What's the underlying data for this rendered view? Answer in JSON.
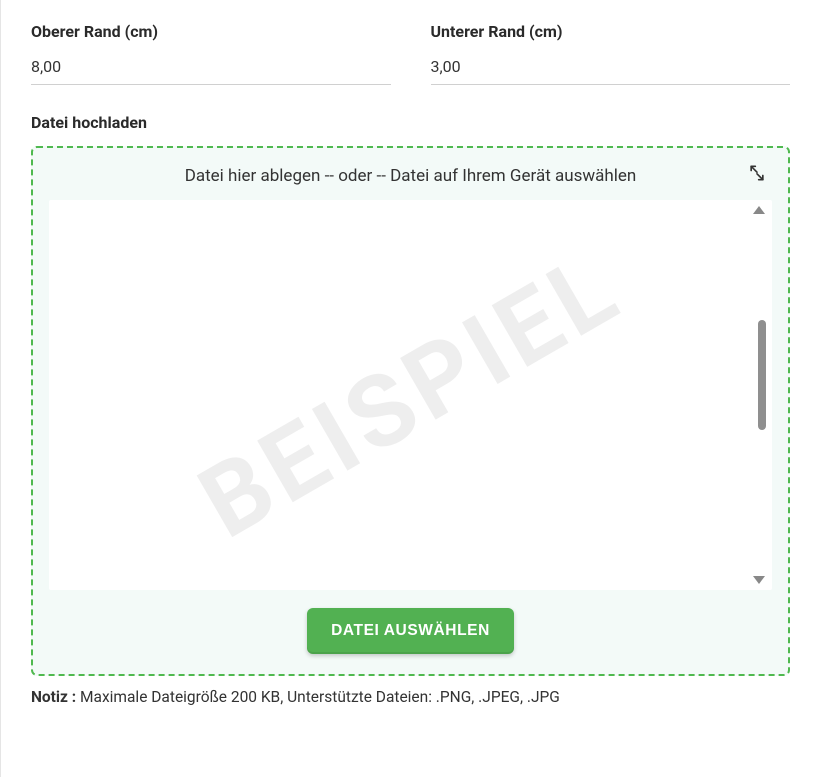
{
  "fields": {
    "topMargin": {
      "label": "Oberer Rand (cm)",
      "value": "8,00"
    },
    "bottomMargin": {
      "label": "Unterer Rand (cm)",
      "value": "3,00"
    }
  },
  "upload": {
    "label": "Datei hochladen",
    "hint": "Datei hier ablegen -- oder -- Datei auf Ihrem Gerät auswählen",
    "watermark": "BEISPIEL",
    "buttonLabel": "DATEI AUSWÄHLEN"
  },
  "note": {
    "prefix": "Notiz :",
    "text": " Maximale Dateigröße 200 KB, Unterstützte Dateien: .PNG, .JPEG, .JPG"
  }
}
